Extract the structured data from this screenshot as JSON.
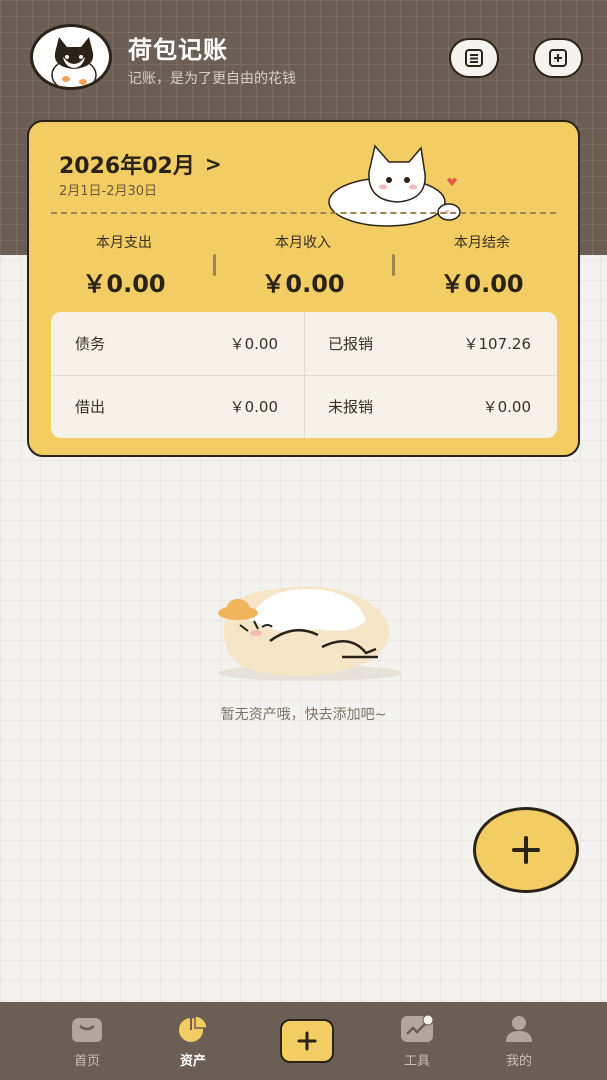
{
  "header": {
    "title": "荷包记账",
    "subtitle": "记账，是为了更自由的花钱",
    "buttons": [
      {
        "icon": "list-icon"
      },
      {
        "icon": "add-square-icon"
      }
    ]
  },
  "summary": {
    "month": "2026年02月",
    "date_range": "2月1日-2月30日",
    "stats": [
      {
        "label": "本月支出",
        "value": "￥0.00"
      },
      {
        "label": "本月收入",
        "value": "￥0.00"
      },
      {
        "label": "本月结余",
        "value": "￥0.00"
      }
    ],
    "details": [
      {
        "label": "债务",
        "value": "￥0.00"
      },
      {
        "label": "已报销",
        "value": "￥107.26"
      },
      {
        "label": "借出",
        "value": "￥0.00"
      },
      {
        "label": "未报销",
        "value": "￥0.00"
      }
    ]
  },
  "empty_state": {
    "text": "暂无资产哦，快去添加吧~"
  },
  "fab": {
    "icon": "plus-icon"
  },
  "tabbar": {
    "items": [
      {
        "label": "首页",
        "icon": "home-icon",
        "active": false
      },
      {
        "label": "资产",
        "icon": "pie-chart-icon",
        "active": true
      },
      {
        "label": "",
        "icon": "plus-icon",
        "active": false
      },
      {
        "label": "工具",
        "icon": "tools-icon",
        "active": false
      },
      {
        "label": "我的",
        "icon": "user-icon",
        "active": false
      }
    ]
  },
  "colors": {
    "accent": "#f2cd63",
    "header": "#6b5e55",
    "background": "#f3f2ef",
    "outline": "#2b2218"
  }
}
